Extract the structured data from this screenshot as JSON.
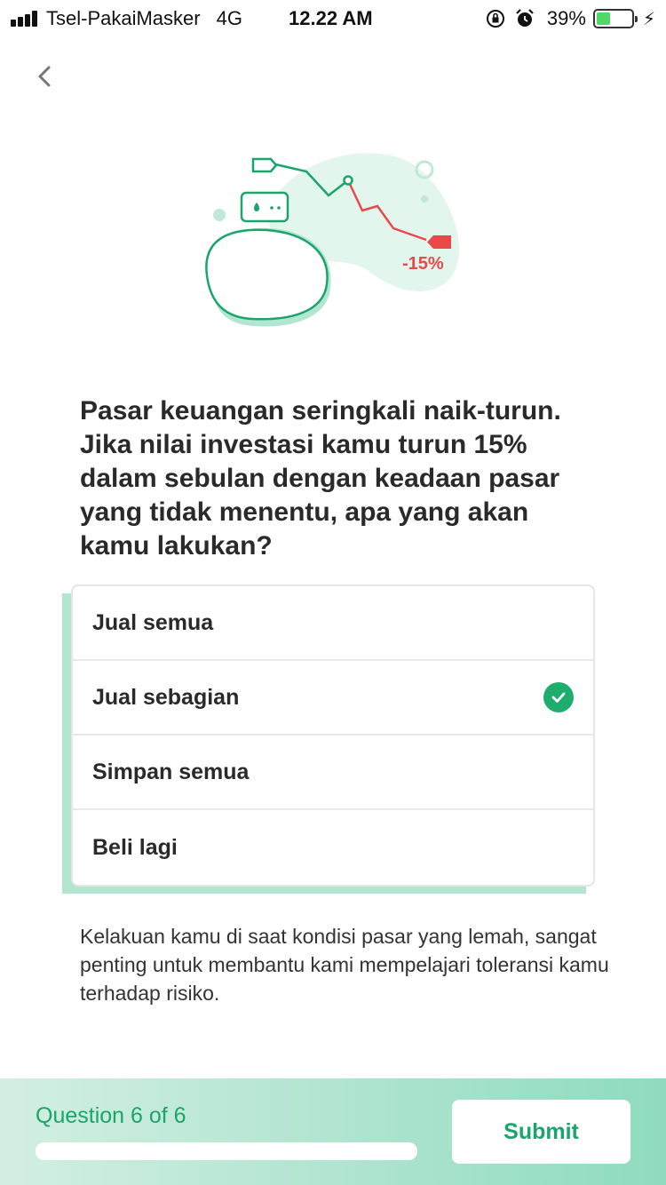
{
  "status_bar": {
    "carrier": "Tsel-PakaiMasker",
    "network": "4G",
    "time": "12.22 AM",
    "battery": "39%",
    "battery_level": 0.39
  },
  "illustration": {
    "change_label": "-15%"
  },
  "question": "Pasar keuangan seringkali naik-turun. Jika nilai investasi kamu turun 15% dalam sebulan dengan keadaan pasar yang tidak menentu, apa yang akan kamu lakukan?",
  "options": [
    {
      "label": "Jual semua",
      "selected": false
    },
    {
      "label": "Jual sebagian",
      "selected": true
    },
    {
      "label": "Simpan semua",
      "selected": false
    },
    {
      "label": "Beli lagi",
      "selected": false
    }
  ],
  "note": "Kelakuan kamu di saat kondisi pasar yang lemah, sangat penting untuk membantu kami mempelajari toleransi kamu terhadap risiko.",
  "footer": {
    "progress_label": "Question 6 of 6",
    "progress": 1.0,
    "submit_label": "Submit"
  },
  "colors": {
    "accent": "#1aa56a",
    "loss": "#e84a4a",
    "highlight": "#b2e6d0"
  },
  "icons": {
    "back": "chevron-left-icon",
    "selected": "check-circle-icon",
    "alarm": "alarm-icon",
    "orientation_lock": "rotation-lock-icon",
    "charging": "bolt-icon"
  }
}
